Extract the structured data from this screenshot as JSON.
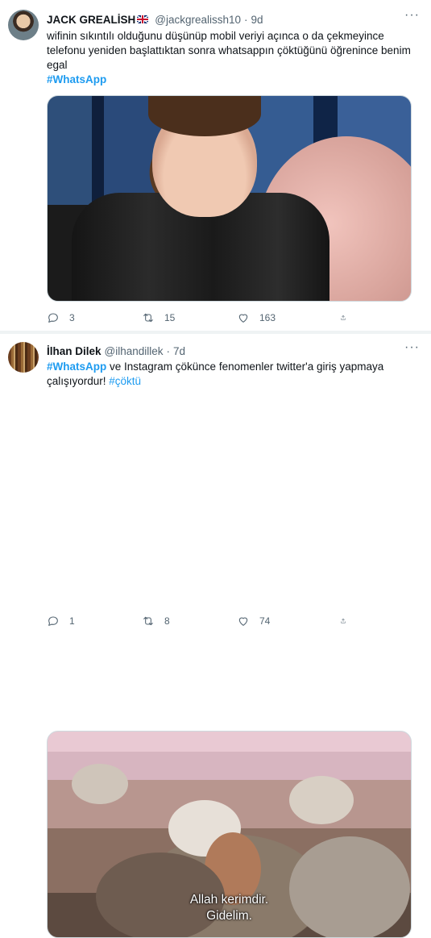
{
  "tweets": [
    {
      "author": {
        "name": "JACK GREALİSH",
        "flag": "uk-flag-icon",
        "handle": "@jackgrealissh10",
        "time": "9d"
      },
      "text": "wifinin sıkıntılı olduğunu düşünüp mobil veriyi açınca o da çekmeyince telefonu yeniden başlattıktan sonra whatsappın çöktüğünü öğrenince benim egal",
      "hashtag": "#WhatsApp",
      "stats": {
        "replies": "3",
        "retweets": "15",
        "likes": "163"
      }
    },
    {
      "author": {
        "name": "İlhan Dilek",
        "handle": "@ilhandillek",
        "time": "7d"
      },
      "hashtag": "#WhatsApp",
      "text": " ve Instagram çökünce fenomenler twitter'a giriş yapmaya çalışıyordur! ",
      "hashtag2": "#çöktü",
      "subtitle": [
        "Allah kerimdir.",
        "Gidelim."
      ],
      "stats": {
        "replies": "1",
        "retweets": "8",
        "likes": "74"
      }
    }
  ],
  "colors": {
    "accent": "#1d9bf0",
    "secondary_text": "#536471",
    "separator": "#eff3f4"
  }
}
